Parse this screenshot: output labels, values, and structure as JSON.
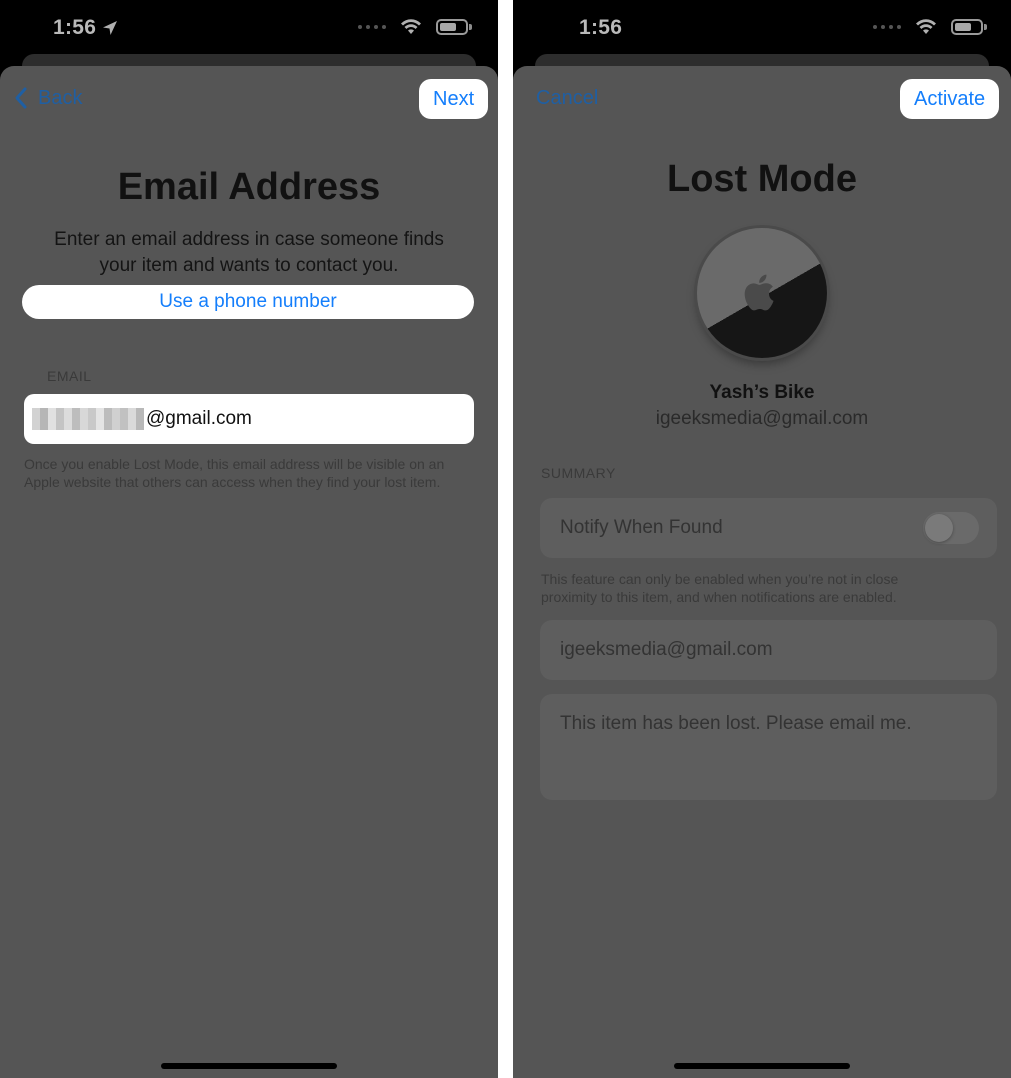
{
  "left_screen": {
    "status_time": "1:56",
    "nav": {
      "back_label": "Back",
      "next_label": "Next"
    },
    "title": "Email Address",
    "description": "Enter an email address in case someone finds your item and wants to contact you.",
    "phone_link": "Use a phone number",
    "email_section_label": "EMAIL",
    "email_domain": "@gmail.com",
    "footnote": "Once you enable Lost Mode, this email address will be visible on an Apple website that others can access when they find your lost item."
  },
  "right_screen": {
    "status_time": "1:56",
    "nav": {
      "cancel_label": "Cancel",
      "activate_label": "Activate"
    },
    "title": "Lost Mode",
    "item_name": "Yash’s Bike",
    "item_email": "igeeksmedia@gmail.com",
    "summary_label": "SUMMARY",
    "notify_label": "Notify When Found",
    "notify_enabled": false,
    "notify_footnote": "This feature can only be enabled when you’re not in close proximity to this item, and when notifications are enabled.",
    "contact_email": "igeeksmedia@gmail.com",
    "message": "This item has been lost. Please email me."
  },
  "icons": {
    "back": "chevron-left-icon",
    "location": "location-arrow-icon",
    "wifi": "wifi-icon",
    "battery": "battery-icon",
    "airtag": "airtag-image"
  },
  "colors": {
    "accent": "#147efb",
    "dimmed_accent": "#1f5fa3",
    "overlay": "#555555"
  }
}
